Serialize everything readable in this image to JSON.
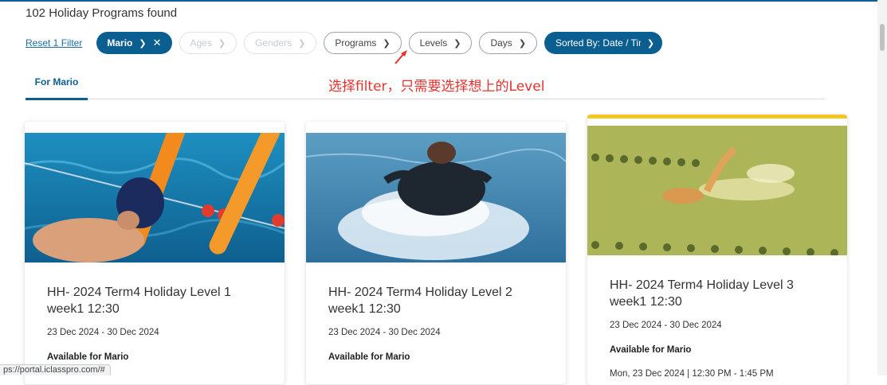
{
  "header": {
    "results_title": "102 Holiday Programs found"
  },
  "filters": {
    "reset_label": "Reset 1 Filter",
    "student_chip": "Mario",
    "ages_chip": "Ages",
    "genders_chip": "Genders",
    "programs_chip": "Programs",
    "levels_chip": "Levels",
    "days_chip": "Days",
    "sorted_chip": "Sorted By: Date / Tim"
  },
  "annotation": {
    "text": "选择filter，只需要选择想上的Level",
    "color": "#e5322d"
  },
  "tabs": [
    {
      "label": "For Mario",
      "active": true
    }
  ],
  "cards": [
    {
      "title": "HH- 2024 Term4 Holiday Level 1 week1 12:30",
      "dates": "23 Dec 2024 - 30 Dec 2024",
      "availability": "Available for Mario",
      "image_icon": "swimmer-with-pool-noodles-photo"
    },
    {
      "title": "HH- 2024 Term4 Holiday Level 2 week1 12:30",
      "dates": "23 Dec 2024 - 30 Dec 2024",
      "availability": "Available for Mario",
      "image_icon": "child-swimming-splash-photo"
    },
    {
      "title": "HH- 2024 Term4 Holiday Level 3 week1 12:30",
      "dates": "23 Dec 2024 - 30 Dec 2024",
      "availability": "Available for Mario",
      "schedule_partial": "Mon, 23 Dec 2024   |   12:30 PM - 1:45 PM",
      "image_icon": "freestyle-swimmer-photo",
      "highlighted": true
    }
  ],
  "status_bar": {
    "url": "ps://portal.iclasspro.com/#"
  },
  "colors": {
    "brand_blue": "#0b5e90",
    "highlight_gold": "#f3c623"
  }
}
